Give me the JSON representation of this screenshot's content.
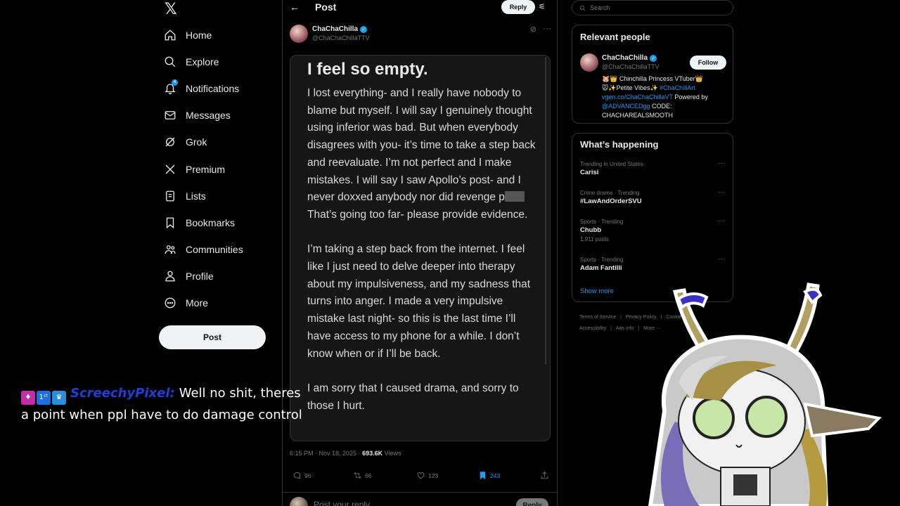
{
  "nav": {
    "items": [
      {
        "label": "Home",
        "icon": "home-icon"
      },
      {
        "label": "Explore",
        "icon": "search-icon"
      },
      {
        "label": "Notifications",
        "icon": "bell-icon"
      },
      {
        "label": "Messages",
        "icon": "mail-icon"
      },
      {
        "label": "Grok",
        "icon": "grok-icon"
      },
      {
        "label": "Premium",
        "icon": "x-icon"
      },
      {
        "label": "Lists",
        "icon": "list-icon"
      },
      {
        "label": "Bookmarks",
        "icon": "bookmark-icon"
      },
      {
        "label": "Communities",
        "icon": "people-icon"
      },
      {
        "label": "Profile",
        "icon": "person-icon"
      },
      {
        "label": "More",
        "icon": "more-circle-icon"
      }
    ],
    "post_label": "Post",
    "notif_count": "4"
  },
  "main": {
    "title": "Post",
    "reply_label": "Reply",
    "author": {
      "name": "ChaChaChilla",
      "handle": "@ChaChaChillaTTV"
    },
    "note": {
      "title": "I feel so empty.",
      "p1a": "I lost everything- and I really have nobody to blame but myself. I will say I genuinely thought using inferior was bad. But when everybody disagrees with you- it’s time to take a step back and reevaluate. I’m not perfect and I make mistakes. I will say I saw Apollo’s post- and I never doxxed anybody nor did revenge p",
      "p1b": " That’s going too far- please provide evidence.",
      "p2": "I’m taking a step back from the internet. I feel like I just need to delve deeper into therapy about my impulsiveness, and my sadness that turns into anger. I made a very impulsive mistake last night- so this is the last time I’ll have access to my phone for a while. I don’t know when or if I’ll be back.",
      "p3": "I am sorry that I caused drama, and sorry to those I hurt."
    },
    "meta": {
      "time": "6:15 PM · Nov 18, 2025 · ",
      "views": "693.6K",
      "views_label": " Views"
    },
    "actions": {
      "replies": "96",
      "reposts": "66",
      "likes": "123",
      "bookmarks": "243"
    },
    "reply_placeholder": "Post your reply",
    "reply_button": "Reply"
  },
  "right": {
    "search_placeholder": "Search",
    "relevant_title": "Relevant people",
    "person": {
      "name": "ChaChaChilla",
      "handle": "@ChaChaChillaTTV",
      "follow": "Follow",
      "bio1": "🐹👑 Chinchilla Princess VTuber👑",
      "bio2a": "🐭✨Petite Vibes✨ ",
      "bio2b": "#ChaChillArt",
      "bio3a": "vgen.co/ChaChaChillaVT",
      "bio3b": " Powered by",
      "bio4a": "@ADVANCEDgg",
      "bio4b": " CODE:",
      "bio5": "CHACHAREALSMOOTH"
    },
    "happening_title": "What’s happening",
    "trends": [
      {
        "context": "Trending in United States",
        "title": "Carisi",
        "count": ""
      },
      {
        "context": "Crime drama · Trending",
        "title": "#LawAndOrderSVU",
        "count": ""
      },
      {
        "context": "Sports · Trending",
        "title": "Chubb",
        "count": "1,911 posts"
      },
      {
        "context": "Sports · Trending",
        "title": "Adam Fantilli",
        "count": ""
      }
    ],
    "show_more": "Show more",
    "footer": [
      "Terms of Service",
      "|",
      "Privacy Policy",
      "|",
      "Cookie",
      "Accessibility",
      "|",
      "Ads info",
      "|",
      "More ···"
    ]
  },
  "chat": {
    "username": "ScreechyPixel:",
    "message": "Well no shit, theres a point when ppl have to do damage control"
  },
  "colors": {
    "accent": "#1d9bf0",
    "bg": "#000000",
    "text": "#e7e9ea",
    "muted": "#71767b"
  }
}
